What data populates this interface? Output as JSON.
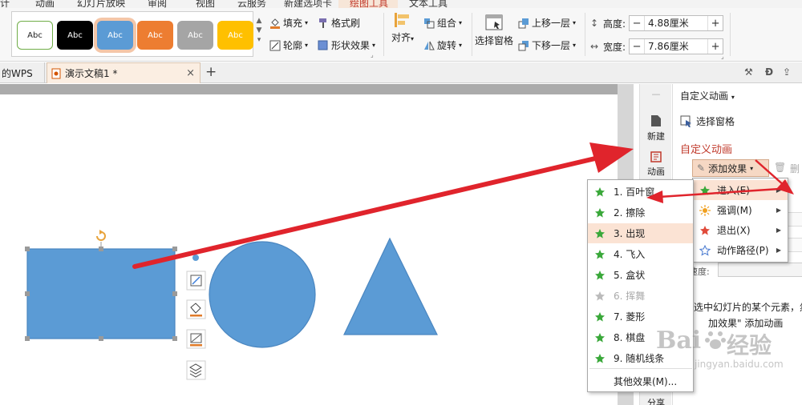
{
  "menu_bar": {
    "items": [
      "计",
      "动画",
      "幻灯片放映",
      "审阅",
      "视图",
      "云服务",
      "新建选项卡",
      "绘图工具",
      "文本工具"
    ]
  },
  "ribbon": {
    "swatches": [
      {
        "label": "Abc",
        "bg": "#ffffff",
        "fg": "#222222",
        "border": "#70ad47"
      },
      {
        "label": "Abc",
        "bg": "#000000",
        "fg": "#ffffff",
        "border": "#000000"
      },
      {
        "label": "Abc",
        "bg": "#5b9bd5",
        "fg": "#ffffff",
        "border": "#5b9bd5"
      },
      {
        "label": "Abc",
        "bg": "#ed7d31",
        "fg": "#ffffff",
        "border": "#ed7d31"
      },
      {
        "label": "Abc",
        "bg": "#a5a5a5",
        "fg": "#ffffff",
        "border": "#a5a5a5"
      },
      {
        "label": "Abc",
        "bg": "#ffc000",
        "fg": "#ffffff",
        "border": "#ffc000"
      }
    ],
    "fill_label": "填充",
    "format_painter_label": "格式刷",
    "outline_label": "轮廓",
    "shape_effect_label": "形状效果",
    "align_label": "对齐",
    "group_label": "组合",
    "rotate_label": "旋转",
    "selection_pane_label": "选择窗格",
    "bring_forward_label": "上移一层",
    "send_backward_label": "下移一层",
    "height_label": "高度:",
    "height_value": "4.88厘米",
    "width_label": "宽度:",
    "width_value": "7.86厘米",
    "minus": "−",
    "plus": "+"
  },
  "tabs": {
    "wps_tab_label": "的WPS",
    "doc_tab_label": "演示文稿1 *",
    "close": "×",
    "new_tab": "+"
  },
  "sidenav": {
    "new_label": "新建",
    "animation_label": "动画",
    "share_label": "分享"
  },
  "taskpane": {
    "custom_animation_dropdown": "自定义动画",
    "selection_pane_label": "选择窗格",
    "section_title": "自定义动画",
    "add_effect_label": "添加效果",
    "delete_label": "删",
    "speed_label": "速度:",
    "hint_line1": "选中幻灯片的某个元素，然",
    "hint_line2": "加效果\" 添加动画"
  },
  "add_effect_menu": {
    "items": [
      {
        "label": "进入(E)",
        "icon": "green-star-icon"
      },
      {
        "label": "强调(M)",
        "icon": "sun-icon"
      },
      {
        "label": "退出(X)",
        "icon": "red-star-icon"
      },
      {
        "label": "动作路径(P)",
        "icon": "outline-star-icon"
      }
    ]
  },
  "entrance_menu": {
    "items": [
      "1. 百叶窗",
      "2. 擦除",
      "3. 出现",
      "4. 飞入",
      "5. 盒状",
      "6. 挥舞",
      "7. 菱形",
      "8. 棋盘",
      "9. 随机线条"
    ],
    "more_label": "其他效果(M)..."
  },
  "watermark": {
    "brand": "Bai",
    "text": "经验",
    "url": "jingyan.baidu.com"
  },
  "colors": {
    "shape_fill": "#5b9bd5",
    "shape_stroke": "#4a86c0",
    "arrow": "#e0242c",
    "accent": "#c0392b",
    "highlight": "#fbe3d4"
  }
}
